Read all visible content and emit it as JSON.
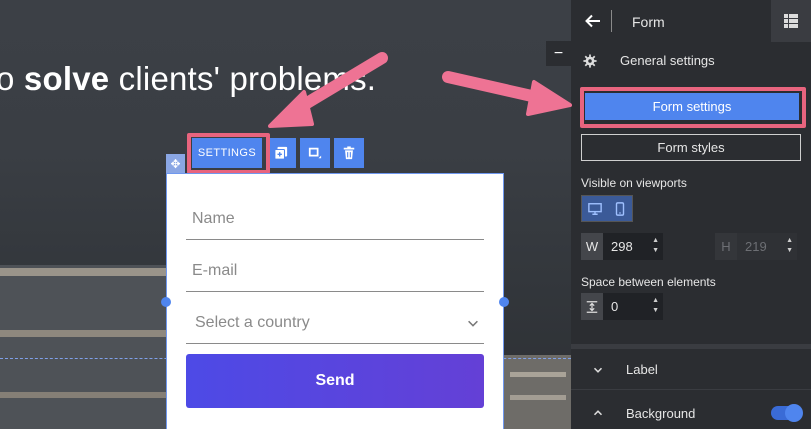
{
  "canvas": {
    "hero_prefix": "o ",
    "hero_bold": "solve",
    "hero_suffix": " clients' problems.",
    "toolbar": {
      "settings_label": "SETTINGS",
      "icons": [
        "duplicate-icon",
        "layer-icon",
        "trash-icon"
      ]
    },
    "form": {
      "name_placeholder": "Name",
      "email_placeholder": "E-mail",
      "country_placeholder": "Select a country",
      "send_label": "Send"
    },
    "colors": {
      "accent": "#4f85ee",
      "highlight": "#e8647e",
      "send_gradient_start": "#4d4ae6",
      "send_gradient_end": "#6440d6"
    }
  },
  "panel": {
    "title": "Form",
    "general_settings": "General settings",
    "form_settings_button": "Form settings",
    "form_styles_button": "Form styles",
    "visible_on_viewports": "Visible on viewports",
    "width": {
      "label": "W",
      "value": "298"
    },
    "height": {
      "label": "H",
      "value": "219"
    },
    "space_between_label": "Space between elements",
    "space_between_value": "0",
    "sections": {
      "label": "Label",
      "background": "Background"
    },
    "background_toggle_on": true
  }
}
